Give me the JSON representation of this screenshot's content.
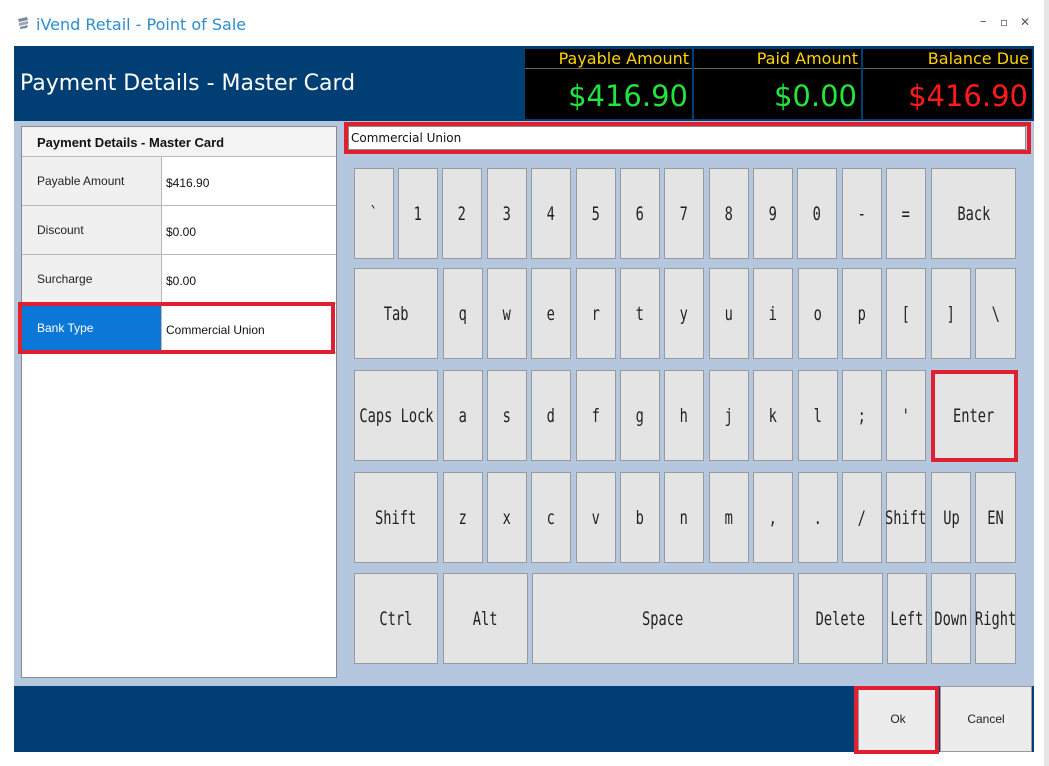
{
  "window": {
    "title": "iVend Retail - Point of Sale",
    "minimize": "–",
    "maximize": "▫",
    "close": "✕"
  },
  "header": {
    "title": "Payment Details - Master Card",
    "payable_label": "Payable Amount",
    "payable_value": "$416.90",
    "paid_label": "Paid Amount",
    "paid_value": "$0.00",
    "balance_label": "Balance Due",
    "balance_value": "$416.90"
  },
  "details": {
    "title": "Payment Details - Master Card",
    "rows": [
      {
        "label": "Payable Amount",
        "value": "$416.90"
      },
      {
        "label": "Discount",
        "value": "$0.00"
      },
      {
        "label": "Surcharge",
        "value": "$0.00"
      },
      {
        "label": "Bank Type",
        "value": "Commercial Union"
      }
    ]
  },
  "keyboard": {
    "input_value": "Commercial Union",
    "row1": [
      "`",
      "1",
      "2",
      "3",
      "4",
      "5",
      "6",
      "7",
      "8",
      "9",
      "0",
      "-",
      "=",
      "Back"
    ],
    "row2": [
      "Tab",
      "q",
      "w",
      "e",
      "r",
      "t",
      "y",
      "u",
      "i",
      "o",
      "p",
      "[",
      "]",
      "\\"
    ],
    "row3": [
      "Caps Lock",
      "a",
      "s",
      "d",
      "f",
      "g",
      "h",
      "j",
      "k",
      "l",
      ";",
      "'",
      "Enter"
    ],
    "row4": [
      "Shift",
      "z",
      "x",
      "c",
      "v",
      "b",
      "n",
      "m",
      ",",
      ".",
      "/",
      "Shift",
      "Up",
      "EN"
    ],
    "row5": [
      "Ctrl",
      "Alt",
      "Space",
      "Delete",
      "Left",
      "Down",
      "Right"
    ]
  },
  "footer": {
    "ok_label": "Ok",
    "cancel_label": "Cancel"
  },
  "colors": {
    "header_bg": "#003e73",
    "panel_bg": "#b5c7de",
    "payable_color": "#22e43a",
    "paid_color": "#22e43a",
    "balance_color": "#ff1a1a",
    "label_yellow": "#ffd400",
    "selected_row": "#0b78d8",
    "highlight_red": "#e02030"
  }
}
